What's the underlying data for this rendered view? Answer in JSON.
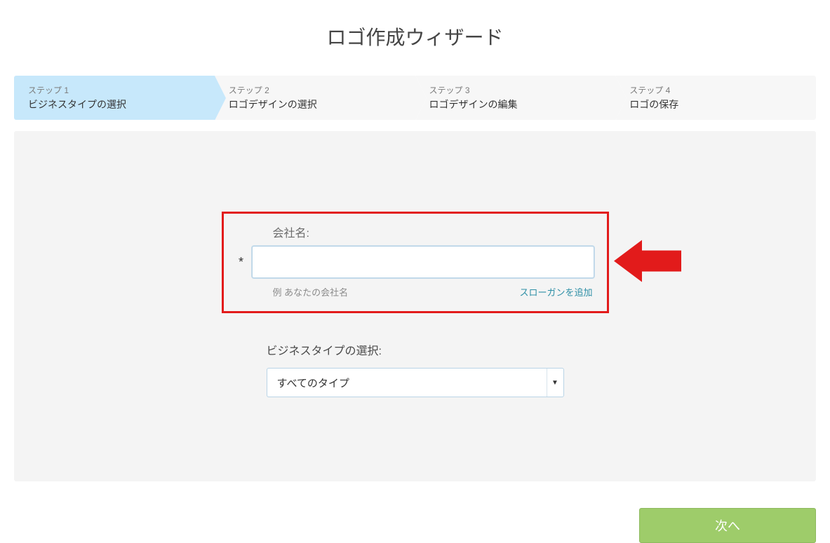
{
  "title": "ロゴ作成ウィザード",
  "steps": [
    {
      "num": "ステップ 1",
      "label": "ビジネスタイプの選択",
      "active": true
    },
    {
      "num": "ステップ 2",
      "label": "ロゴデザインの選択",
      "active": false
    },
    {
      "num": "ステップ 3",
      "label": "ロゴデザインの編集",
      "active": false
    },
    {
      "num": "ステップ 4",
      "label": "ロゴの保存",
      "active": false
    }
  ],
  "company": {
    "label": "会社名:",
    "required_mark": "*",
    "value": "",
    "example": "例  あなたの会社名",
    "slogan_link": "スローガンを追加"
  },
  "business": {
    "label": "ビジネスタイプの選択:",
    "selected": "すべてのタイプ"
  },
  "next_label": "次へ"
}
